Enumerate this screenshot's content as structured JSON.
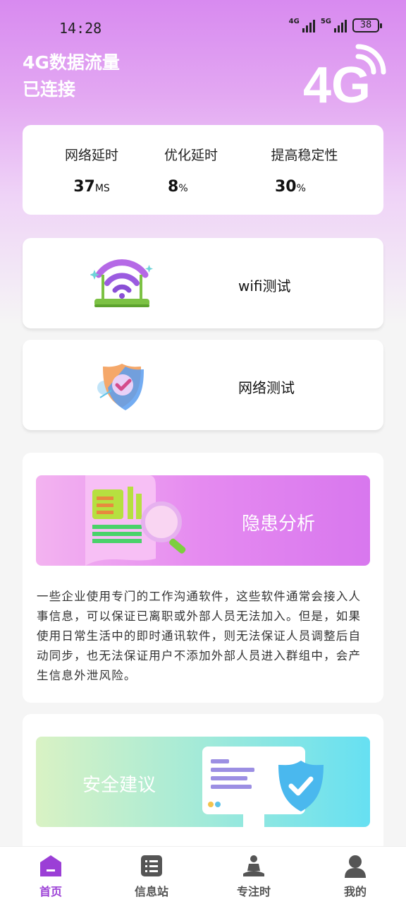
{
  "status_bar": {
    "time": "14:28",
    "signal1_label": "4G",
    "signal2_label": "5G",
    "battery": "38"
  },
  "header": {
    "line1": "4G数据流量",
    "line2": "已连接",
    "logo_icon": "4g-wifi-logo"
  },
  "stats": [
    {
      "label": "网络延时",
      "value": "37",
      "unit": "MS"
    },
    {
      "label": "优化延时",
      "value": "8",
      "unit": "%"
    },
    {
      "label": "提高稳定性",
      "value": "30",
      "unit": "%"
    }
  ],
  "tools": [
    {
      "label": "wifi测试",
      "icon": "wifi-router-icon"
    },
    {
      "label": "网络测试",
      "icon": "shield-check-icon"
    }
  ],
  "risk_panel": {
    "banner_title": "隐患分析",
    "description": "一些企业使用专门的工作沟通软件，这些软件通常会接入人事信息，可以保证已离职或外部人员无法加入。但是，如果使用日常生活中的即时通讯软件，则无法保证人员调整后自动同步，也无法保证用户不添加外部人员进入群组中，会产生信息外泄风险。"
  },
  "advice_panel": {
    "banner_title": "安全建议"
  },
  "tabbar": [
    {
      "label": "首页",
      "icon": "home-icon",
      "active": true
    },
    {
      "label": "信息站",
      "icon": "list-icon",
      "active": false
    },
    {
      "label": "专注时",
      "icon": "meditation-icon",
      "active": false
    },
    {
      "label": "我的",
      "icon": "user-icon",
      "active": false
    }
  ],
  "colors": {
    "accent": "#9b3fd6",
    "header_gradient_top": "#d88af0",
    "background": "#f5f5f5"
  }
}
